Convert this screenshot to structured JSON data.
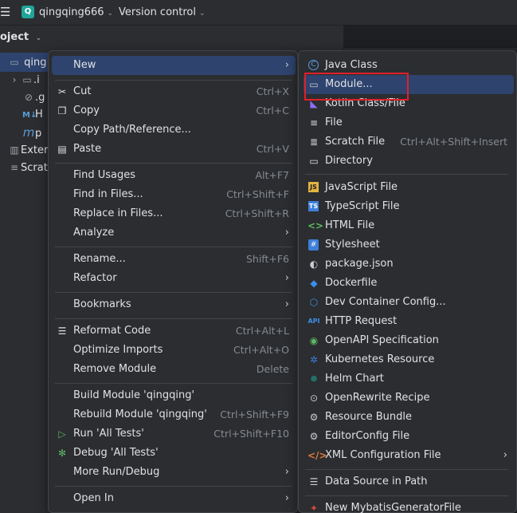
{
  "titlebar": {
    "project_badge": "Q",
    "project_name": "qingqing666",
    "vcs_label": "Version control"
  },
  "panel": {
    "title": "oject",
    "tree": [
      {
        "label": "qing",
        "icon": "module-icon"
      },
      {
        "label": ".i",
        "icon": "folder-icon"
      },
      {
        "label": ".g",
        "icon": "ignore-icon"
      },
      {
        "label": "H",
        "icon": "markdown-icon"
      },
      {
        "label": "p",
        "icon": "maven-icon"
      },
      {
        "label": "Exter",
        "icon": "library-icon"
      },
      {
        "label": "Scrat",
        "icon": "scratch-icon"
      }
    ]
  },
  "main_menu": {
    "items": [
      {
        "label": "New",
        "shortcut": "",
        "submenu": true
      },
      {
        "label": "Cut",
        "shortcut": "Ctrl+X"
      },
      {
        "label": "Copy",
        "shortcut": "Ctrl+C"
      },
      {
        "label": "Copy Path/Reference...",
        "shortcut": ""
      },
      {
        "label": "Paste",
        "shortcut": "Ctrl+V"
      },
      {
        "label": "Find Usages",
        "shortcut": "Alt+F7"
      },
      {
        "label": "Find in Files...",
        "shortcut": "Ctrl+Shift+F"
      },
      {
        "label": "Replace in Files...",
        "shortcut": "Ctrl+Shift+R"
      },
      {
        "label": "Analyze",
        "shortcut": "",
        "submenu": true
      },
      {
        "label": "Rename...",
        "shortcut": "Shift+F6"
      },
      {
        "label": "Refactor",
        "shortcut": "",
        "submenu": true
      },
      {
        "label": "Bookmarks",
        "shortcut": "",
        "submenu": true
      },
      {
        "label": "Reformat Code",
        "shortcut": "Ctrl+Alt+L"
      },
      {
        "label": "Optimize Imports",
        "shortcut": "Ctrl+Alt+O"
      },
      {
        "label": "Remove Module",
        "shortcut": "Delete"
      },
      {
        "label": "Build Module 'qingqing'",
        "shortcut": ""
      },
      {
        "label": "Rebuild Module 'qingqing'",
        "shortcut": "Ctrl+Shift+F9"
      },
      {
        "label": "Run 'All Tests'",
        "shortcut": "Ctrl+Shift+F10"
      },
      {
        "label": "Debug 'All Tests'",
        "shortcut": ""
      },
      {
        "label": "More Run/Debug",
        "shortcut": "",
        "submenu": true
      },
      {
        "label": "Open In",
        "shortcut": "",
        "submenu": true
      }
    ]
  },
  "new_submenu": {
    "items": [
      {
        "label": "Java Class",
        "icon": "java-class-icon"
      },
      {
        "label": "Module...",
        "icon": "module-icon"
      },
      {
        "label": "Kotlin Class/File",
        "icon": "kotlin-icon"
      },
      {
        "label": "File",
        "icon": "file-icon"
      },
      {
        "label": "Scratch File",
        "icon": "scratch-file-icon",
        "shortcut": "Ctrl+Alt+Shift+Insert"
      },
      {
        "label": "Directory",
        "icon": "directory-icon"
      },
      {
        "label": "JavaScript File",
        "icon": "javascript-icon"
      },
      {
        "label": "TypeScript File",
        "icon": "typescript-icon"
      },
      {
        "label": "HTML File",
        "icon": "html-icon"
      },
      {
        "label": "Stylesheet",
        "icon": "css-icon"
      },
      {
        "label": "package.json",
        "icon": "npm-icon"
      },
      {
        "label": "Dockerfile",
        "icon": "docker-icon"
      },
      {
        "label": "Dev Container Config...",
        "icon": "dev-container-icon"
      },
      {
        "label": "HTTP Request",
        "icon": "api-icon"
      },
      {
        "label": "OpenAPI Specification",
        "icon": "openapi-icon"
      },
      {
        "label": "Kubernetes Resource",
        "icon": "kubernetes-icon"
      },
      {
        "label": "Helm Chart",
        "icon": "helm-icon"
      },
      {
        "label": "OpenRewrite Recipe",
        "icon": "openrewrite-icon"
      },
      {
        "label": "Resource Bundle",
        "icon": "resource-bundle-icon"
      },
      {
        "label": "EditorConfig File",
        "icon": "editorconfig-icon"
      },
      {
        "label": "XML Configuration File",
        "icon": "xml-icon",
        "submenu": true
      },
      {
        "label": "Data Source in Path",
        "icon": "database-icon"
      },
      {
        "label": "New MybatisGeneratorFile",
        "icon": "mybatis-icon"
      }
    ]
  },
  "icons": {
    "apiBadge": "API",
    "jsBadge": "JS",
    "tsBadge": "TS"
  },
  "colors": {
    "highlight": "#2e436e",
    "annotation_box": "#e0202a"
  }
}
